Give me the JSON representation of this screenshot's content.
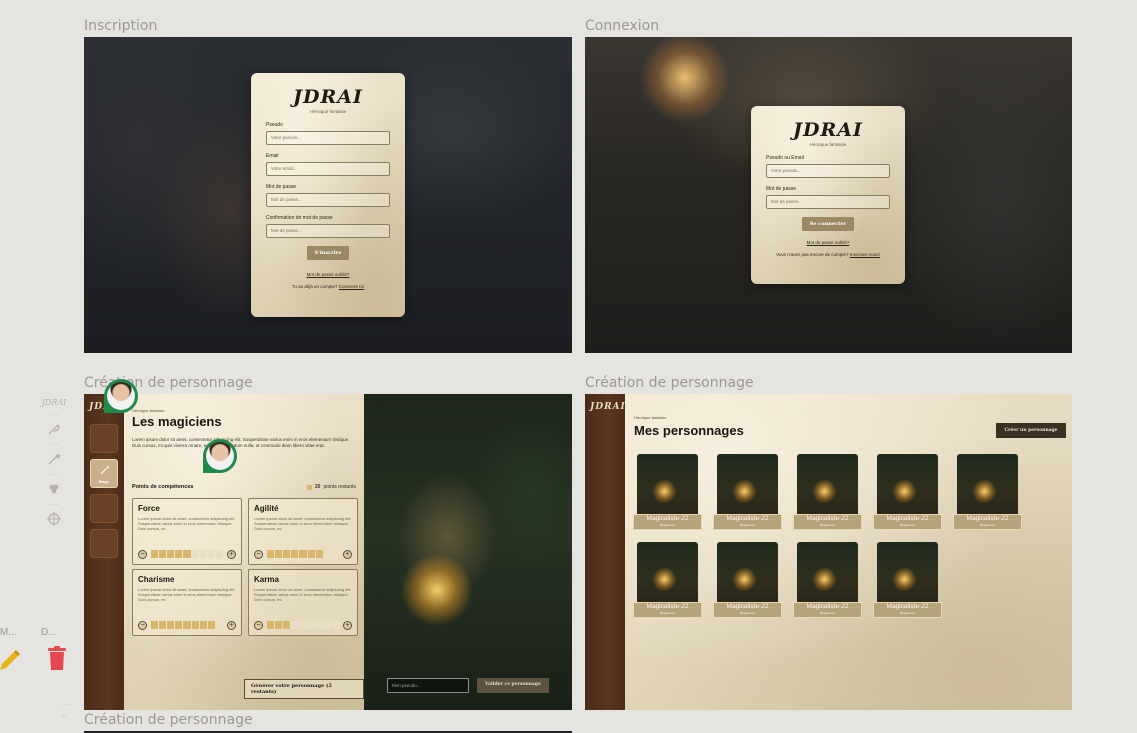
{
  "frames": {
    "inscription": {
      "label": "Inscription"
    },
    "connexion": {
      "label": "Connexion"
    },
    "creation_left": {
      "label": "Création de personnage"
    },
    "creation_right": {
      "label": "Création de personnage"
    },
    "creation_bottom": {
      "label": "Création de personnage"
    }
  },
  "brand": {
    "logo": "JDRAI",
    "tagline": "Héroïque fantaisie",
    "mini_logo": "JDRAI"
  },
  "signup": {
    "pseudo_label": "Pseudo",
    "pseudo_placeholder": "Votre pseudo...",
    "email_label": "Email",
    "email_placeholder": "Votre email...",
    "password_label": "Mot de passe",
    "password_placeholder": "Mot de passe...",
    "confirm_label": "Confirmation de mot de passe",
    "confirm_placeholder": "Mot de passe...",
    "submit": "S'inscrire",
    "forgot": "Mot de passe oublié?",
    "footer_text": "Tu as déjà un compte?",
    "footer_link": "Connecte toi"
  },
  "login": {
    "id_label": "Pseudo ou Email",
    "id_placeholder": "Votre pseudo...",
    "password_label": "Mot de passe",
    "password_placeholder": "Mot de passe...",
    "submit": "Se connecter",
    "forgot": "Mot de passe oublié?",
    "footer_text": "Vous n'avez pas encore de compte?",
    "footer_link": "Inscrivez-vous!"
  },
  "creation": {
    "kicker": "Héroïque fantaisie",
    "title": "Les magiciens",
    "intro": "Lorem ipsum dolor sit amet, consectetur adipiscing elit. Suspendisse varius enim in eros elementum tristique. Duis cursus, mi quis viverra ornare, eros dolor interdum nulla, ut commodo diam libero vitae erat.",
    "active_class": "Mage",
    "points_title": "Points de compétences",
    "points_value": "20",
    "points_suffix": "points restants",
    "skill_desc": "Lorem ipsum dolor sit amet, consectetur adipiscing elit. Suspendisse varius enim in eros elementum tristique. Duis cursus, mi.",
    "skills": [
      {
        "name": "Force",
        "level": 5
      },
      {
        "name": "Agilité",
        "level": 7
      },
      {
        "name": "Charisme",
        "level": 8
      },
      {
        "name": "Karma",
        "level": 3
      }
    ],
    "skill_max": 9,
    "minus": "−",
    "plus": "+",
    "generate_button": "Générer votre personnage (2 restants)",
    "pseudo_placeholder": "Mon pseudo...",
    "validate_button": "Valider ce personnage"
  },
  "characters": {
    "kicker": "Héroïque fantaisie",
    "title": "Mes personnages",
    "create_button": "Créer un personnage",
    "role": "Magicienne",
    "names": [
      "Magicaliste-22",
      "Magicaliste-22",
      "Magicaliste-22",
      "Magicaliste-22",
      "Magicaliste-22",
      "Magicaliste-22",
      "Magicaliste-22",
      "Magicaliste-22",
      "Magicaliste-22"
    ]
  },
  "bottom_tools": {
    "label_m": "M...",
    "label_d": "D..."
  },
  "colors": {
    "accent_green": "#1f8a4b",
    "danger_red": "#e5484d",
    "pencil_yellow": "#e7b416"
  }
}
